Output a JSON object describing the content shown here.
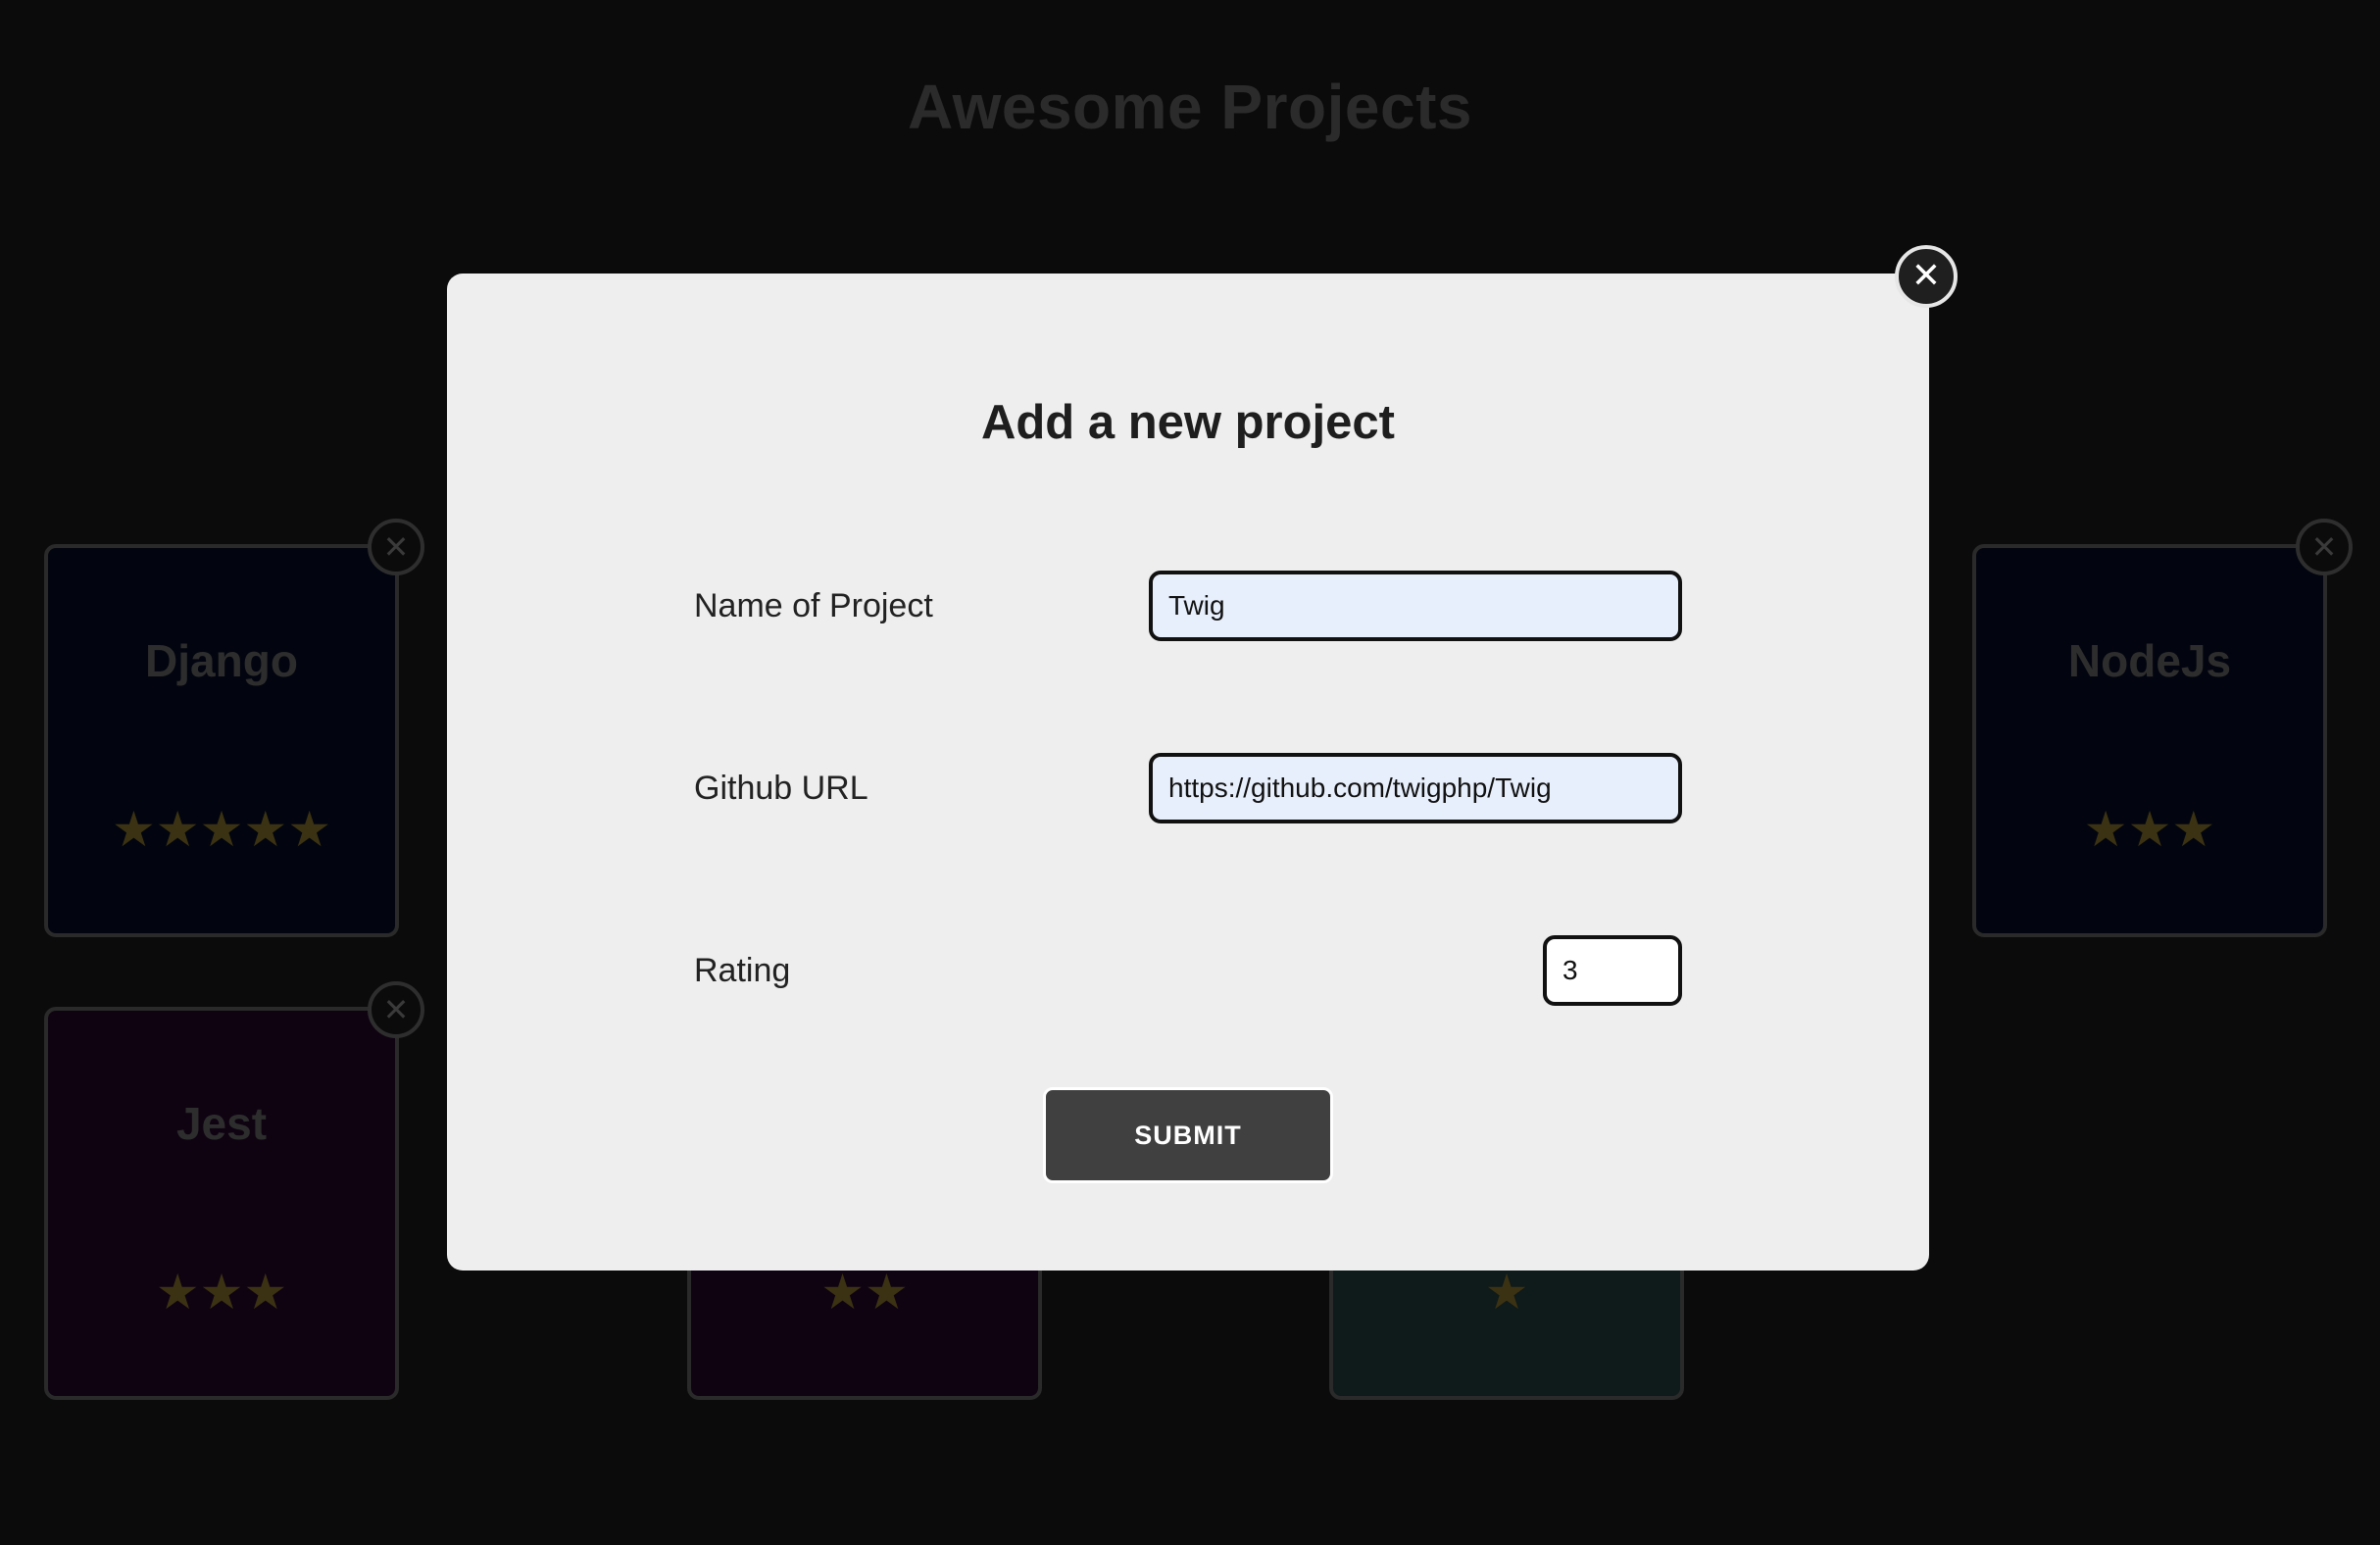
{
  "page": {
    "title": "Awesome Projects"
  },
  "cards": [
    {
      "name": "Django",
      "rating": 5,
      "stars": "★★★★★",
      "close": "✕",
      "bg": "#02050f"
    },
    {
      "name": "NodeJs",
      "rating": 3,
      "stars": "★★★",
      "close": "✕",
      "bg": "#02050f"
    },
    {
      "name": "Jest",
      "rating": 3,
      "stars": "★★★",
      "close": "✕",
      "bg": "#0f0312"
    },
    {
      "name": "",
      "rating": 2,
      "stars": "★★",
      "bg": "#0f0312"
    },
    {
      "name": "",
      "rating": 1,
      "stars": "★",
      "bg": "#0f1a1a"
    }
  ],
  "modal": {
    "title": "Add a new project",
    "close_icon": "✕",
    "fields": {
      "name": {
        "label": "Name of Project",
        "value": "Twig"
      },
      "github": {
        "label": "Github URL",
        "value": "https://github.com/twigphp/Twig"
      },
      "rating": {
        "label": "Rating",
        "value": "3"
      }
    },
    "submit_label": "SUBMIT"
  },
  "colors": {
    "overlay_bg": "#0b0b0b",
    "modal_bg": "#eeeeee",
    "input_bg": "#e8effc",
    "button_bg": "#404040",
    "star_dim": "#3b3213"
  }
}
